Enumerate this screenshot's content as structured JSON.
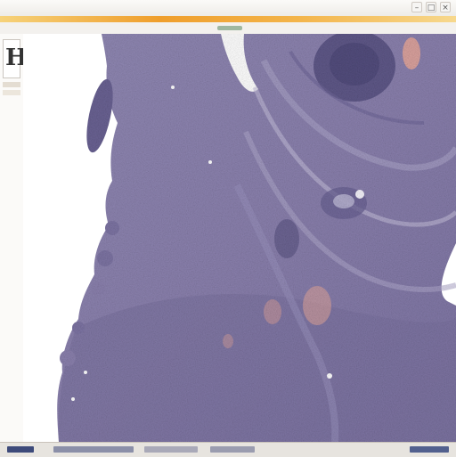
{
  "window": {
    "title": "",
    "controls": [
      {
        "name": "minimize",
        "glyph": "–"
      },
      {
        "name": "maximize",
        "glyph": "□"
      },
      {
        "name": "close",
        "glyph": "×"
      }
    ]
  },
  "sidebar": {
    "icon_glyph": "H",
    "icon_name": "image-thumbnail-icon"
  },
  "viewer": {
    "image_name": "tissue-histology-slide",
    "stain_colors": {
      "hematoxylin_purple": "#8a80ad",
      "dark_purple": "#6a6293",
      "eosin_pink": "#e6a79a",
      "background": "#ffffff"
    }
  },
  "colors": {
    "accent": "#ef9e2c",
    "chrome": "#f3f1ee",
    "statusbar": "#e7e4df"
  }
}
